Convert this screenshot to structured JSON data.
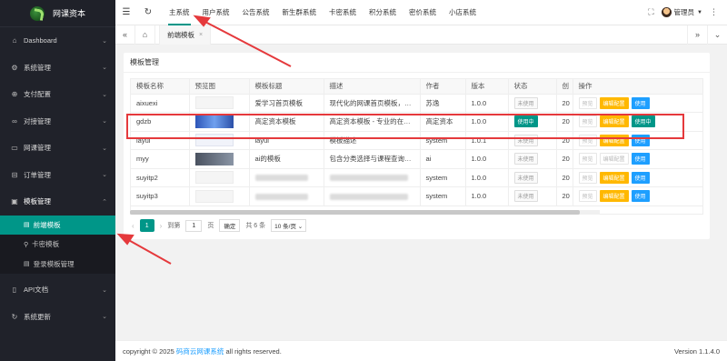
{
  "app": {
    "title": "网课资本"
  },
  "sidebar": {
    "items": [
      {
        "label": "Dashboard",
        "icon": "home-icon"
      },
      {
        "label": "系统管理",
        "icon": "gear-icon"
      },
      {
        "label": "支付配置",
        "icon": "pay-icon"
      },
      {
        "label": "对接管理",
        "icon": "link-icon"
      },
      {
        "label": "网课管理",
        "icon": "book-icon"
      },
      {
        "label": "订单管理",
        "icon": "order-icon"
      },
      {
        "label": "模板管理",
        "icon": "template-icon"
      }
    ],
    "submenu": [
      {
        "label": "前端模板"
      },
      {
        "label": "卡密模板"
      },
      {
        "label": "登录模板管理"
      }
    ],
    "bottom": [
      {
        "label": "API文档"
      },
      {
        "label": "系统更新"
      }
    ]
  },
  "header": {
    "tabs": [
      "主系统",
      "用户系统",
      "公告系统",
      "新生群系统",
      "卡密系统",
      "积分系统",
      "密价系统",
      "小店系统"
    ],
    "user": "管理员"
  },
  "tabstrip": {
    "tab": "前端模板"
  },
  "card": {
    "title": "模板管理",
    "columns": [
      "模板名称",
      "预览图",
      "模板标题",
      "描述",
      "作者",
      "版本",
      "状态",
      "创",
      "操作"
    ],
    "rows": [
      {
        "name": "aixuexi",
        "title": "爱学习首页模板",
        "desc": "现代化的网课首页模板，…",
        "author": "苏逸",
        "version": "1.0.0",
        "status": "未使用",
        "created": "20",
        "active": false
      },
      {
        "name": "gdzb",
        "title": "高定资本模板",
        "desc": "高定资本模板 - 专业的在…",
        "author": "高定资本",
        "version": "1.0.0",
        "status": "使用中",
        "created": "20",
        "active": true
      },
      {
        "name": "layui",
        "title": "layui",
        "desc": "模板描述",
        "author": "system",
        "version": "1.0.1",
        "status": "未使用",
        "created": "20",
        "active": false
      },
      {
        "name": "myy",
        "title": "ai的模板",
        "desc": "包含分类选择与课程查询…",
        "author": "ai",
        "version": "1.0.0",
        "status": "未使用",
        "created": "20",
        "active": false
      },
      {
        "name": "suyitp2",
        "title": "",
        "desc": "",
        "author": "system",
        "version": "1.0.0",
        "status": "未使用",
        "created": "20",
        "active": false
      },
      {
        "name": "suyitp3",
        "title": "",
        "desc": "",
        "author": "system",
        "version": "1.0.0",
        "status": "未使用",
        "created": "20",
        "active": false
      }
    ],
    "ops": {
      "preview": "预览",
      "edit": "编辑配置",
      "use": "使用",
      "using": "使用中"
    },
    "pager": {
      "current": "1",
      "goto_label": "到第",
      "page_input": "1",
      "page_unit": "页",
      "confirm": "确定",
      "total": "共 6 条",
      "page_size": "10 条/页"
    }
  },
  "footer": {
    "copyright_prefix": "copyright © 2025",
    "link": "码商云网课系统",
    "copyright_suffix": "all rights reserved.",
    "version": "Version 1.1.4.0"
  }
}
